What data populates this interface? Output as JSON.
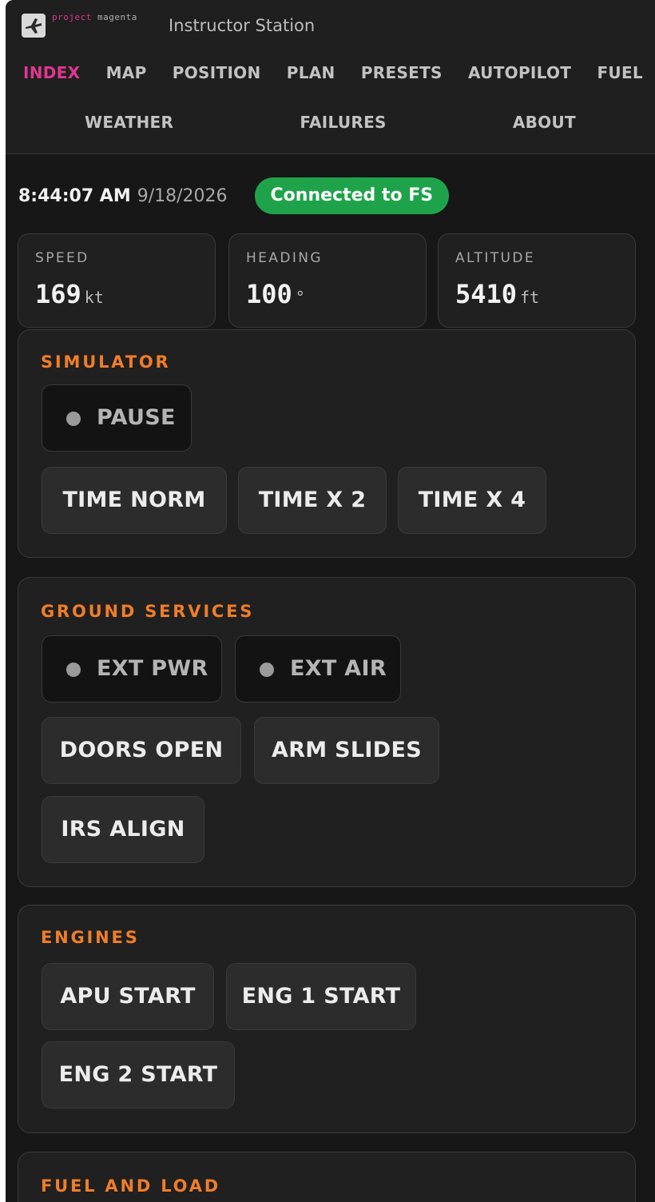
{
  "brand": {
    "logo_line1": "project",
    "logo_line2": "magenta",
    "title": "Instructor Station"
  },
  "nav": {
    "row1": [
      "INDEX",
      "MAP",
      "POSITION",
      "PLAN",
      "PRESETS",
      "AUTOPILOT",
      "FUEL"
    ],
    "row2": [
      "WEATHER",
      "FAILURES",
      "ABOUT"
    ],
    "active": "INDEX"
  },
  "status": {
    "time": "8:44:07 AM",
    "date": "9/18/2026",
    "connection": "Connected to FS"
  },
  "stats": [
    {
      "label": "SPEED",
      "value": "169",
      "unit": "kt"
    },
    {
      "label": "HEADING",
      "value": "100",
      "unit": "°"
    },
    {
      "label": "ALTITUDE",
      "value": "5410",
      "unit": "ft"
    }
  ],
  "simulator": {
    "title": "SIMULATOR",
    "pause": "PAUSE",
    "time_norm": "TIME NORM",
    "time_x2": "TIME X 2",
    "time_x4": "TIME X 4"
  },
  "ground": {
    "title": "GROUND SERVICES",
    "ext_pwr": "EXT PWR",
    "ext_air": "EXT AIR",
    "doors_open": "DOORS OPEN",
    "arm_slides": "ARM SLIDES",
    "irs_align": "IRS ALIGN"
  },
  "engines": {
    "title": "ENGINES",
    "apu_start": "APU START",
    "eng1_start": "ENG 1 START",
    "eng2_start": "ENG 2 START"
  },
  "fuel_load": {
    "title": "FUEL AND LOAD"
  },
  "colors": {
    "accent_magenta": "#e0368f",
    "section_orange": "#f07d2a",
    "connected_green": "#1fa34a",
    "background": "#171717"
  }
}
